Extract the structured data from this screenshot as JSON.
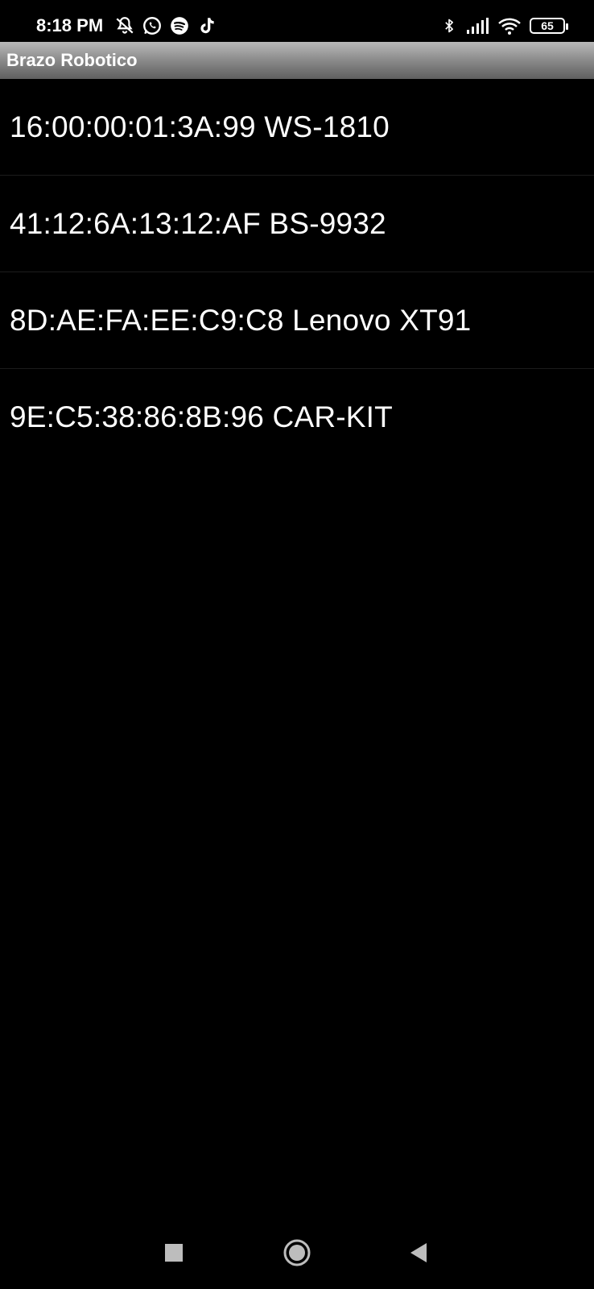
{
  "status_bar": {
    "time": "8:18 PM",
    "battery_level": "65",
    "left_icons": [
      "notifications-muted-icon",
      "whatsapp-icon",
      "spotify-icon",
      "tiktok-icon"
    ],
    "right_icons": [
      "bluetooth-icon",
      "signal-icon",
      "wifi-icon",
      "battery-icon"
    ]
  },
  "app": {
    "title": "Brazo Robotico"
  },
  "devices": [
    {
      "label": "16:00:00:01:3A:99 WS-1810"
    },
    {
      "label": "41:12:6A:13:12:AF BS-9932"
    },
    {
      "label": "8D:AE:FA:EE:C9:C8 Lenovo XT91"
    },
    {
      "label": "9E:C5:38:86:8B:96 CAR-KIT"
    }
  ],
  "nav_bar": {
    "buttons": [
      "recents-button",
      "home-button",
      "back-button"
    ]
  },
  "colors": {
    "background": "#000000",
    "text": "#ffffff",
    "title_bar_top": "#b9b9b9",
    "title_bar_bottom": "#5f5f5f",
    "divider": "#1c1c1c"
  }
}
